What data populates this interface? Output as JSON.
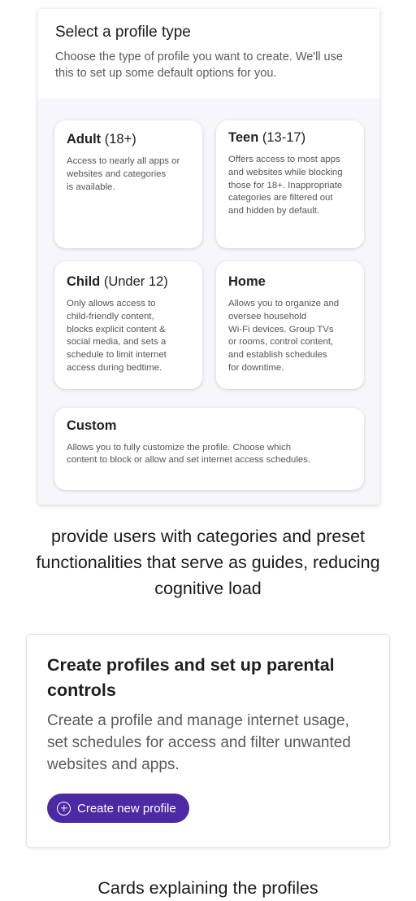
{
  "profile_select": {
    "title": "Select a profile type",
    "subtitle": "Choose the type of profile you want to create. We'll use this to set up some default options for you.",
    "cards": [
      {
        "name": "Adult",
        "age": "(18+)",
        "description": "Access to nearly all apps or\nwebsites and categories\nis available."
      },
      {
        "name": "Teen",
        "age": "(13-17)",
        "description": "Offers access to most apps\nand websites while blocking\nthose for 18+. Inappropriate\ncategories are filtered out\nand hidden by default."
      },
      {
        "name": "Child",
        "age": "(Under 12)",
        "description": "Only allows access to\nchild-friendly content,\nblocks explicit content &\nsocial media, and sets a\nschedule to limit internet\naccess during bedtime."
      },
      {
        "name": "Home",
        "age": "",
        "description": "Allows you to organize and\noversee household\nWi-Fi devices. Group TVs\nor rooms, control content,\nand establish schedules\nfor downtime."
      },
      {
        "name": "Custom",
        "age": "",
        "description": "Allows you to fully customize the profile. Choose which\ncontent to block or allow and set internet access schedules."
      }
    ]
  },
  "caption_top": "provide users with categories and preset functionalities that serve as guides, reducing cognitive load",
  "parental_card": {
    "title": "Create profiles and set up parental controls",
    "description": "Create a profile and manage internet usage, set schedules for access and filter unwanted websites and apps.",
    "button_label": "Create new profile",
    "button_icon": "plus-circle-icon"
  },
  "caption_bottom": "Cards explaining the profiles",
  "colors": {
    "accent": "#4b2aa3",
    "panel_bg": "#f6f6fb"
  }
}
